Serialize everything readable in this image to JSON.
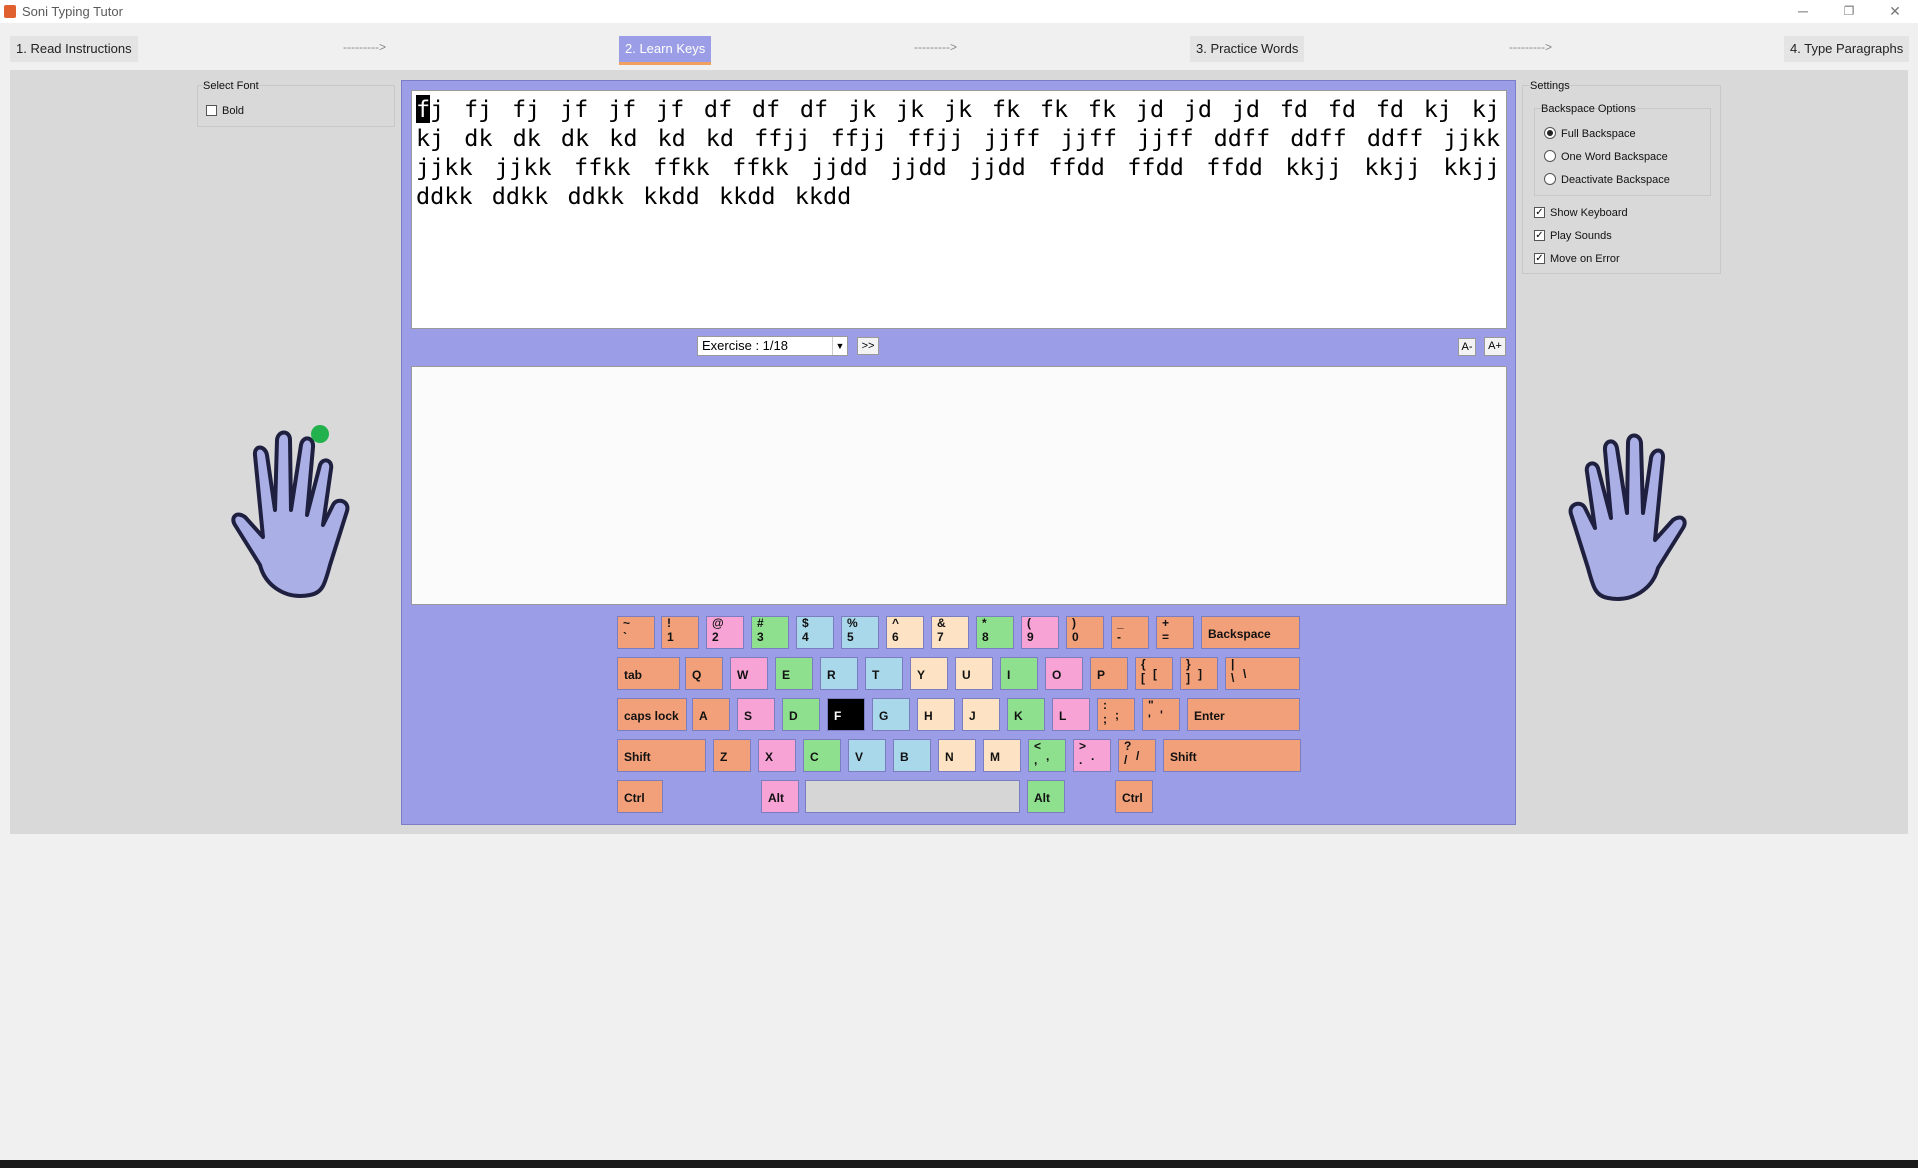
{
  "window": {
    "title": "Soni Typing Tutor",
    "minimize": "─",
    "restore": "❐",
    "close": "✕"
  },
  "steps": [
    {
      "label": "1. Read Instructions"
    },
    {
      "label": "2. Learn Keys"
    },
    {
      "label": "3. Practice Words"
    },
    {
      "label": "4. Type Paragraphs"
    }
  ],
  "arrow": "--------->",
  "font_panel": {
    "title": "Select Font",
    "bold_label": "Bold",
    "bold_checked": false
  },
  "settings": {
    "title": "Settings",
    "backspace_title": "Backspace Options",
    "options": [
      "Full Backspace",
      "One Word Backspace",
      "Deactivate Backspace"
    ],
    "selected_option": "Full Backspace",
    "checks": [
      {
        "label": "Show Keyboard",
        "checked": true,
        "mark": "✓"
      },
      {
        "label": "Play Sounds",
        "checked": true,
        "mark": "✓"
      },
      {
        "label": "Move on Error",
        "checked": true,
        "mark": "✓"
      }
    ]
  },
  "exercise": {
    "current_char": "f",
    "text_rest": "j fj fj jf jf jf df df df jk jk jk fk fk fk jd jd jd fd fd fd kj kj kj dk dk dk kd kd kd ffjj ffjj ffjj jjff jjff jjff ddff ddff ddff jjkk jjkk jjkk ffkk ffkk ffkk jjdd jjdd jjdd ffdd ffdd ffdd kkjj kkjj kkjj ddkk ddkk ddkk kkdd kkdd kkdd",
    "selector_label": "Exercise : 1/18",
    "next_label": ">>",
    "font_smaller": "A-",
    "font_larger": "A+",
    "typed_text": ""
  },
  "keyboard": {
    "row1": [
      {
        "top": "~",
        "bottom": "`",
        "color": "or"
      },
      {
        "top": "!",
        "bottom": "1",
        "color": "or"
      },
      {
        "top": "@",
        "bottom": "2",
        "color": "pk"
      },
      {
        "top": "#",
        "bottom": "3",
        "color": "gr"
      },
      {
        "top": "$",
        "bottom": "4",
        "color": "bl"
      },
      {
        "top": "%",
        "bottom": "5",
        "color": "bl"
      },
      {
        "top": "^",
        "bottom": "6",
        "color": "yl"
      },
      {
        "top": "&",
        "bottom": "7",
        "color": "yl"
      },
      {
        "top": "*",
        "bottom": "8",
        "color": "gr"
      },
      {
        "top": "(",
        "bottom": "9",
        "color": "pk"
      },
      {
        "top": ")",
        "bottom": "0",
        "color": "or"
      },
      {
        "top": "_",
        "bottom": "-",
        "color": "or"
      },
      {
        "top": "+",
        "bottom": "=",
        "color": "or"
      },
      {
        "label": "Backspace",
        "color": "or",
        "wide": true
      }
    ],
    "row2": [
      {
        "label": "tab",
        "color": "or"
      },
      {
        "label": "Q",
        "color": "or"
      },
      {
        "label": "W",
        "color": "pk"
      },
      {
        "label": "E",
        "color": "gr"
      },
      {
        "label": "R",
        "color": "bl"
      },
      {
        "label": "T",
        "color": "bl"
      },
      {
        "label": "Y",
        "color": "yl"
      },
      {
        "label": "U",
        "color": "yl"
      },
      {
        "label": "I",
        "color": "gr"
      },
      {
        "label": "O",
        "color": "pk"
      },
      {
        "label": "P",
        "color": "or"
      },
      {
        "top": "{",
        "bottom": "[",
        "right": "[",
        "color": "or"
      },
      {
        "top": "}",
        "bottom": "]",
        "right": "]",
        "color": "or"
      },
      {
        "top": "|",
        "bottom": "\\",
        "right": "\\",
        "color": "or"
      }
    ],
    "row3": [
      {
        "label": "caps lock",
        "color": "or"
      },
      {
        "label": "A",
        "color": "or"
      },
      {
        "label": "S",
        "color": "pk"
      },
      {
        "label": "D",
        "color": "gr"
      },
      {
        "label": "F",
        "color": "hl"
      },
      {
        "label": "G",
        "color": "bl"
      },
      {
        "label": "H",
        "color": "yl"
      },
      {
        "label": "J",
        "color": "yl"
      },
      {
        "label": "K",
        "color": "gr"
      },
      {
        "label": "L",
        "color": "pk"
      },
      {
        "top": ":",
        "bottom": ";",
        "right": ";",
        "color": "or"
      },
      {
        "top": "\"",
        "bottom": "'",
        "right": "'",
        "color": "or"
      },
      {
        "label": "Enter",
        "color": "or"
      }
    ],
    "row4": [
      {
        "label": "Shift",
        "color": "or"
      },
      {
        "label": "Z",
        "color": "or"
      },
      {
        "label": "X",
        "color": "pk"
      },
      {
        "label": "C",
        "color": "gr"
      },
      {
        "label": "V",
        "color": "bl"
      },
      {
        "label": "B",
        "color": "bl"
      },
      {
        "label": "N",
        "color": "yl"
      },
      {
        "label": "M",
        "color": "yl"
      },
      {
        "top": "<",
        "bottom": ",",
        "right": ",",
        "color": "gr"
      },
      {
        "top": ">",
        "bottom": ".",
        "right": ".",
        "color": "pk"
      },
      {
        "top": "?",
        "bottom": "/",
        "right": "/",
        "color": "or"
      },
      {
        "label": "Shift",
        "color": "or"
      }
    ],
    "row5": [
      {
        "label": "Ctrl",
        "color": "or"
      },
      {
        "label": "Alt",
        "color": "pk"
      },
      {
        "label": "",
        "color": "sp"
      },
      {
        "label": "Alt",
        "color": "gr"
      },
      {
        "label": "Ctrl",
        "color": "or"
      }
    ]
  },
  "colors": {
    "panel": "#9b9ee6",
    "orange": "#f2a07a",
    "pink": "#f8a3d6",
    "green": "#8ee08e",
    "blue": "#a9d8ea",
    "yellow": "#fde3c3",
    "hand": "#aab0e6",
    "indicator": "#22b14c"
  }
}
